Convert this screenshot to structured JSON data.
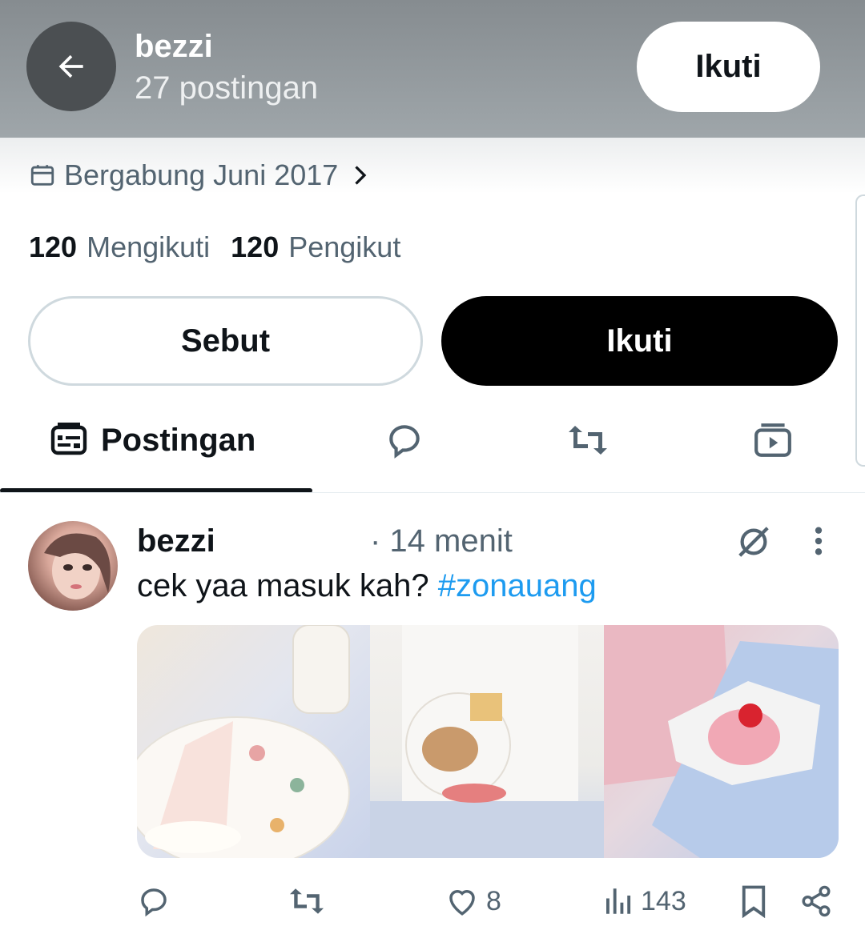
{
  "header": {
    "name": "bezzi",
    "post_count": "27 postingan",
    "follow_label": "Ikuti"
  },
  "profile": {
    "joined": "Bergabung Juni 2017",
    "following_count": "120",
    "following_label": "Mengikuti",
    "followers_count": "120",
    "followers_label": "Pengikut",
    "mention_label": "Sebut",
    "follow_label": "Ikuti"
  },
  "tabs": [
    {
      "label": "Postingan",
      "icon": "posts-icon",
      "active": true
    },
    {
      "label": "",
      "icon": "replies-icon"
    },
    {
      "label": "",
      "icon": "reposts-icon"
    },
    {
      "label": "",
      "icon": "media-icon"
    }
  ],
  "post": {
    "author": "bezzi",
    "time": "· 14 menit",
    "text": "cek yaa masuk kah? ",
    "hashtag": "#zonauang",
    "likes": "8",
    "views": "143"
  },
  "colors": {
    "accent": "#1d9bf0",
    "text_secondary": "#536471",
    "header_bg": "#9aa1a5",
    "button_dark": "#000000"
  }
}
